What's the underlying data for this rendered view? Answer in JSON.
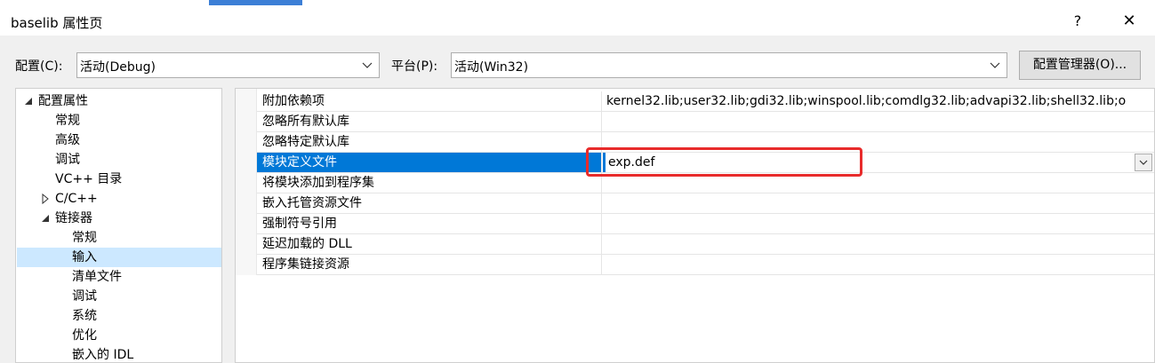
{
  "window": {
    "title": "baselib 属性页",
    "help": "?",
    "close": "✕"
  },
  "config": {
    "label": "配置(C):",
    "value": "活动(Debug)"
  },
  "platform": {
    "label": "平台(P):",
    "value": "活动(Win32)"
  },
  "manager_button": "配置管理器(O)...",
  "tree": {
    "root": "配置属性",
    "items": [
      "常规",
      "高级",
      "调试",
      "VC++ 目录",
      "C/C++",
      "链接器"
    ],
    "linker_children": [
      "常规",
      "输入",
      "清单文件",
      "调试",
      "系统",
      "优化",
      "嵌入的 IDL"
    ]
  },
  "properties": [
    {
      "name": "附加依赖项",
      "value": "kernel32.lib;user32.lib;gdi32.lib;winspool.lib;comdlg32.lib;advapi32.lib;shell32.lib;o"
    },
    {
      "name": "忽略所有默认库",
      "value": ""
    },
    {
      "name": "忽略特定默认库",
      "value": ""
    },
    {
      "name": "模块定义文件",
      "value": "exp.def"
    },
    {
      "name": "将模块添加到程序集",
      "value": ""
    },
    {
      "name": "嵌入托管资源文件",
      "value": ""
    },
    {
      "name": "强制符号引用",
      "value": ""
    },
    {
      "name": "延迟加载的 DLL",
      "value": ""
    },
    {
      "name": "程序集链接资源",
      "value": ""
    }
  ],
  "colors": {
    "selection": "#0078d7",
    "tree_selection": "#cce8ff",
    "highlight": "#e82b2b"
  }
}
